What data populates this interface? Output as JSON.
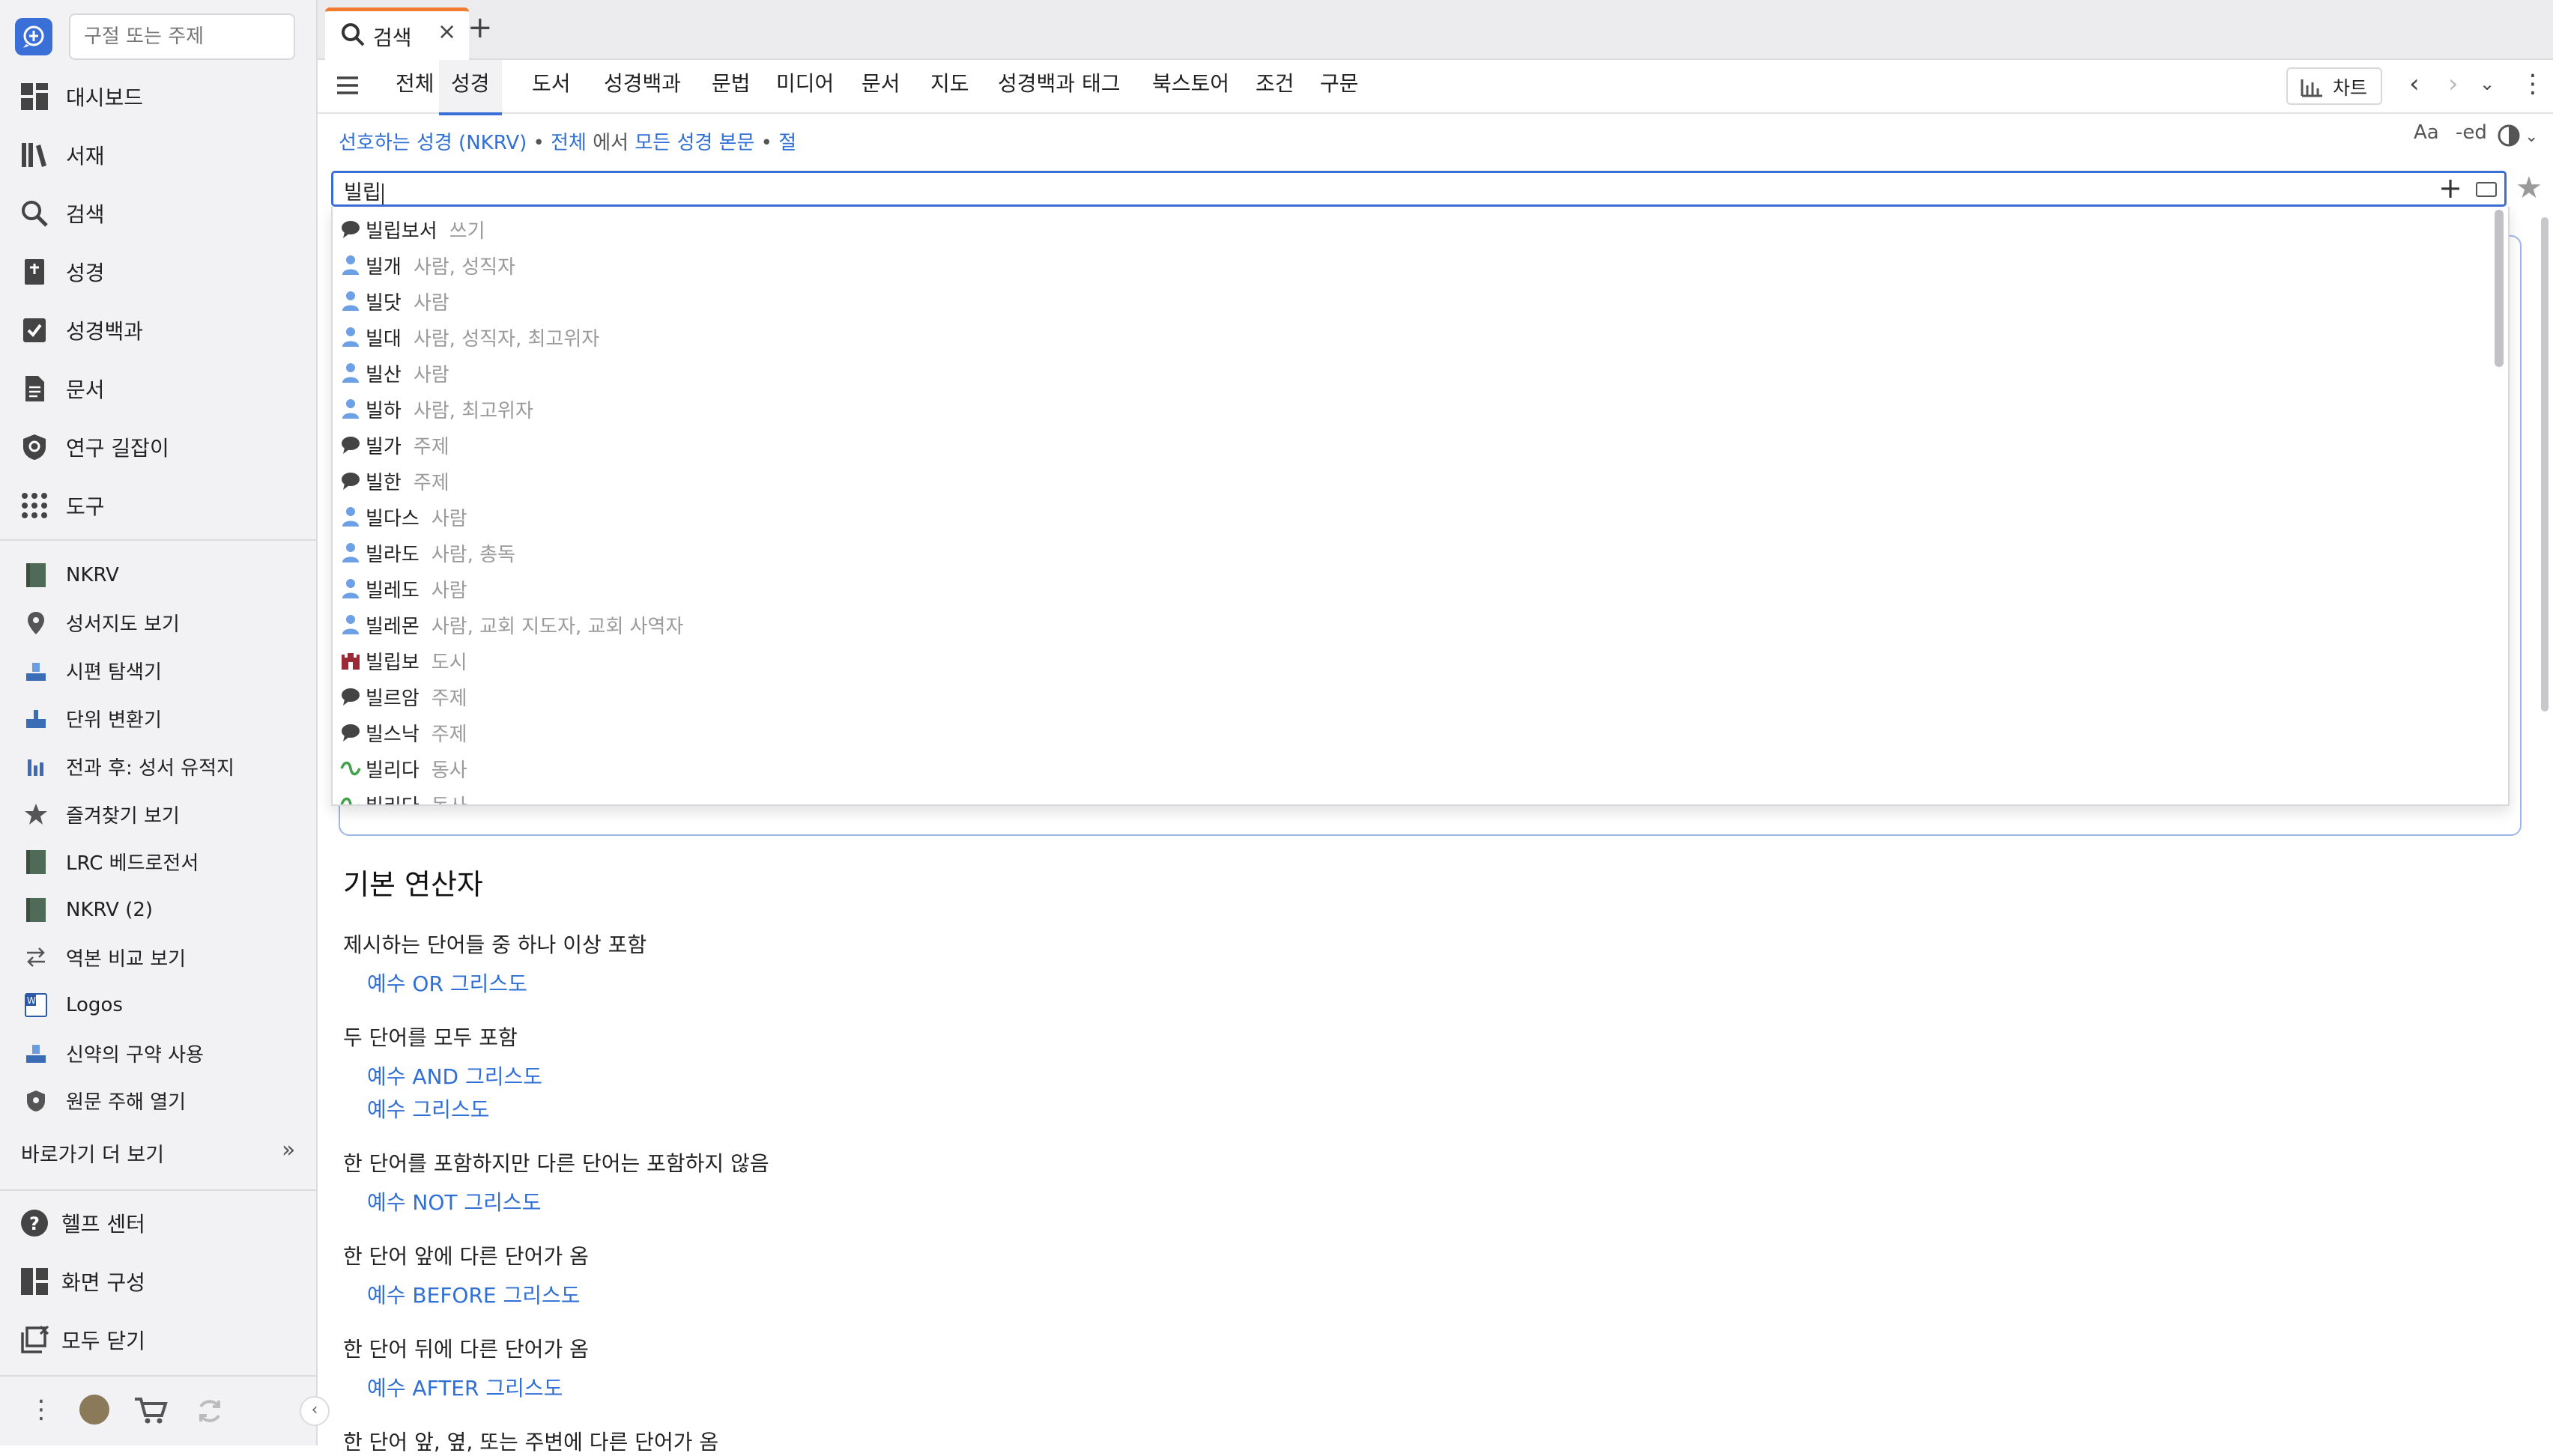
{
  "sidebar": {
    "search_placeholder": "구절 또는 주제",
    "nav": [
      {
        "label": "대시보드",
        "icon": "dashboard-icon"
      },
      {
        "label": "서재",
        "icon": "library-icon"
      },
      {
        "label": "검색",
        "icon": "search-icon"
      },
      {
        "label": "성경",
        "icon": "bible-icon"
      },
      {
        "label": "성경백과",
        "icon": "factbook-icon"
      },
      {
        "label": "문서",
        "icon": "document-icon"
      },
      {
        "label": "연구 길잡이",
        "icon": "guide-icon"
      },
      {
        "label": "도구",
        "icon": "tools-grid-icon"
      }
    ],
    "shortcuts": [
      {
        "label": "NKRV",
        "icon": "book-cover-icon"
      },
      {
        "label": "성서지도 보기",
        "icon": "map-pin-icon"
      },
      {
        "label": "시편 탐색기",
        "icon": "explorer-icon"
      },
      {
        "label": "단위 변환기",
        "icon": "converter-icon"
      },
      {
        "label": "전과 후: 성서 유적지",
        "icon": "sites-icon"
      },
      {
        "label": "즐겨찾기 보기",
        "icon": "star-icon"
      },
      {
        "label": "LRC 베드로전서",
        "icon": "book-cover-icon"
      },
      {
        "label": "NKRV (2)",
        "icon": "book-cover-icon"
      },
      {
        "label": "역본 비교 보기",
        "icon": "compare-arrows-icon"
      },
      {
        "label": "Logos",
        "icon": "word-doc-icon"
      },
      {
        "label": "신약의 구약 사용",
        "icon": "explorer-icon"
      },
      {
        "label": "원문 주해 열기",
        "icon": "shield-icon"
      }
    ],
    "more_label": "바로가기 더 보기",
    "footer": [
      {
        "label": "헬프 센터",
        "icon": "help-icon"
      },
      {
        "label": "화면 구성",
        "icon": "layout-icon"
      },
      {
        "label": "모두 닫기",
        "icon": "close-all-icon"
      }
    ]
  },
  "tabs": [
    {
      "label": "검색"
    }
  ],
  "toolbar": {
    "tabs": [
      "전체",
      "성경",
      "도서",
      "성경백과",
      "문법",
      "미디어",
      "문서",
      "지도",
      "성경백과 태그",
      "북스토어",
      "조건",
      "구문"
    ],
    "active_index": 1,
    "chart_label": "차트"
  },
  "breadcrumb": {
    "bible": "선호하는 성경 (NKRV)",
    "sep1": " • ",
    "scope": "전체",
    "in": " 에서 ",
    "range": "모든 성경 본문",
    "sep2": " • ",
    "unit": "절"
  },
  "right_tools": {
    "font": "Aa",
    "edit": "-ed"
  },
  "search": {
    "value": "빌립"
  },
  "suggestions": [
    {
      "term": "빌립보서",
      "category": "쓰기",
      "icon": "topic-bubble-icon"
    },
    {
      "term": "빌개",
      "category": "사람, 성직자",
      "icon": "person-icon"
    },
    {
      "term": "빌닷",
      "category": "사람",
      "icon": "person-icon"
    },
    {
      "term": "빌대",
      "category": "사람, 성직자, 최고위자",
      "icon": "person-icon"
    },
    {
      "term": "빌산",
      "category": "사람",
      "icon": "person-icon"
    },
    {
      "term": "빌하",
      "category": "사람, 최고위자",
      "icon": "person-icon"
    },
    {
      "term": "빌가",
      "category": "주제",
      "icon": "topic-bubble-icon"
    },
    {
      "term": "빌한",
      "category": "주제",
      "icon": "topic-bubble-icon"
    },
    {
      "term": "빌다스",
      "category": "사람",
      "icon": "person-icon"
    },
    {
      "term": "빌라도",
      "category": "사람, 총독",
      "icon": "person-icon"
    },
    {
      "term": "빌레도",
      "category": "사람",
      "icon": "person-icon"
    },
    {
      "term": "빌레몬",
      "category": "사람, 교회 지도자, 교회 사역자",
      "icon": "person-icon"
    },
    {
      "term": "빌립보",
      "category": "도시",
      "icon": "city-icon"
    },
    {
      "term": "빌르암",
      "category": "주제",
      "icon": "topic-bubble-icon"
    },
    {
      "term": "빌스낙",
      "category": "주제",
      "icon": "topic-bubble-icon"
    },
    {
      "term": "빌리다",
      "category": "동사",
      "icon": "verb-icon"
    },
    {
      "term": "빌리다",
      "category": "동사",
      "icon": "verb-icon"
    }
  ],
  "help": {
    "title": "기본 연산자",
    "sections": [
      {
        "heading": "제시하는 단어들 중 하나 이상 포함",
        "examples": [
          "예수 OR 그리스도"
        ]
      },
      {
        "heading": "두 단어를 모두 포함",
        "examples": [
          "예수 AND 그리스도",
          "예수 그리스도"
        ]
      },
      {
        "heading": "한 단어를 포함하지만 다른 단어는 포함하지 않음",
        "examples": [
          "예수 NOT 그리스도"
        ]
      },
      {
        "heading": "한 단어 앞에 다른 단어가 옴",
        "examples": [
          "예수 BEFORE 그리스도"
        ]
      },
      {
        "heading": "한 단어 뒤에 다른 단어가 옴",
        "examples": [
          "예수 AFTER 그리스도"
        ]
      },
      {
        "heading": "한 단어 앞, 옆, 또는 주변에 다른 단어가 옴",
        "examples": []
      }
    ]
  },
  "colors": {
    "accent": "#3b6fd8",
    "link": "#2f6fd6",
    "tab_accent": "#f07b31"
  }
}
